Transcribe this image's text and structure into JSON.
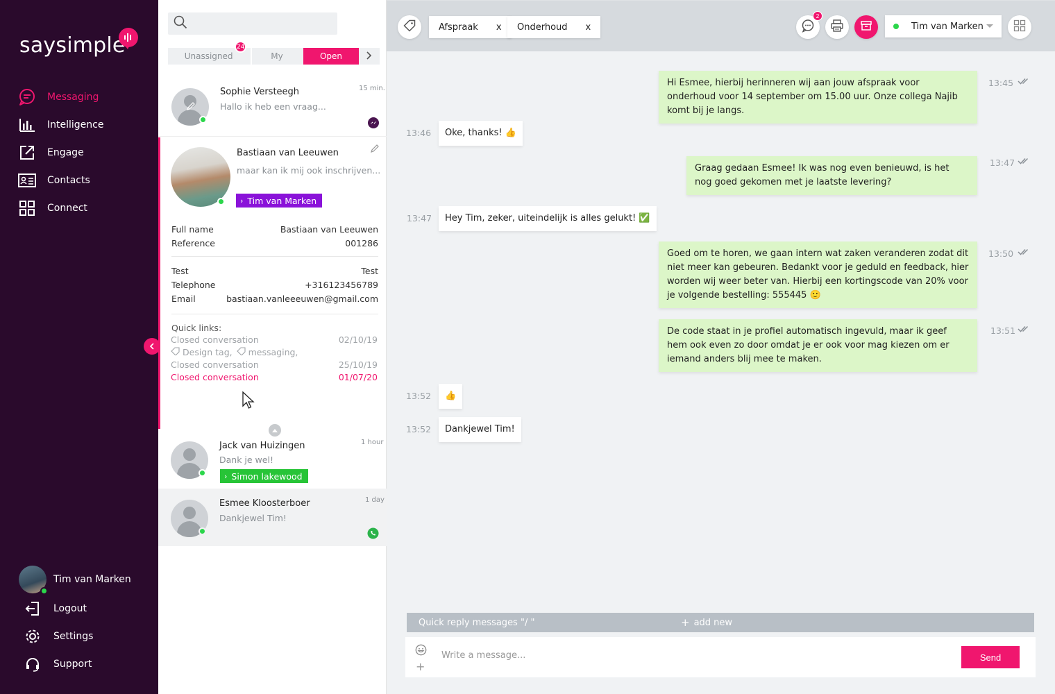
{
  "brand": {
    "name": "saysimple",
    "accent": "#f0166e",
    "sidebar_bg": "#2a0a2c"
  },
  "nav": {
    "items": [
      {
        "label": "Messaging",
        "icon": "chat-icon",
        "active": true
      },
      {
        "label": "Intelligence",
        "icon": "bar-chart-icon"
      },
      {
        "label": "Engage",
        "icon": "external-link-icon"
      },
      {
        "label": "Contacts",
        "icon": "contact-card-icon"
      },
      {
        "label": "Connect",
        "icon": "grid-icon"
      }
    ]
  },
  "user": {
    "name": "Tim van Marken",
    "status": "online"
  },
  "bottom_nav": {
    "logout": "Logout",
    "settings": "Settings",
    "support": "Support"
  },
  "search": {
    "placeholder": ""
  },
  "tabs": {
    "unassigned": "Unassigned",
    "unassigned_count": "24",
    "my": "My",
    "open": "Open"
  },
  "conversations": [
    {
      "name": "Sophie Versteegh",
      "preview": "Hallo ik heb een vraag...",
      "time": "15 min.",
      "channel": "messenger-icon"
    },
    {
      "name": "Bastiaan van Leeuwen",
      "preview": "maar kan ik mij ook inschrijven...",
      "agent": "Tim van Marken",
      "details": {
        "full_name_label": "Full name",
        "full_name": "Bastiaan van Leeuwen",
        "reference_label": "Reference",
        "reference": "001286",
        "test_label": "Test",
        "test": "Test",
        "telephone_label": "Telephone",
        "telephone": "+316123456789",
        "email_label": "Email",
        "email": "bastiaan.vanleeeuwen@gmail.com"
      },
      "quick_links_title": "Quick links:",
      "quick_links": [
        {
          "label": "Closed conversation",
          "date": "02/10/19"
        },
        {
          "tag1": "Design tag,",
          "tag2": "messaging,"
        },
        {
          "label": "Closed conversation",
          "date": "25/10/19"
        },
        {
          "label": "Closed conversation",
          "date": "01/07/20",
          "highlight": true
        }
      ]
    },
    {
      "name": "Jack van Huizingen",
      "preview": "Dank je wel!",
      "time": "1 hour",
      "agent": "Simon lakewood"
    },
    {
      "name": "Esmee Kloosterboer",
      "preview": "Dankjewel Tim!",
      "time": "1 day",
      "channel": "whatsapp-icon"
    }
  ],
  "header": {
    "labels": [
      "Afspraak",
      "Onderhoud"
    ],
    "label_remove": "x",
    "chat_badge": "2",
    "agent": "Tim van Marken"
  },
  "messages": [
    {
      "dir": "out",
      "time": "13:45",
      "text": "Hi Esmee, hierbij herinneren wij aan jouw afspraak voor onderhoud voor 14 september om 15.00 uur. Onze collega Najib komt bij je langs."
    },
    {
      "dir": "in",
      "time": "13:46",
      "text": "Oke, thanks! 👍"
    },
    {
      "dir": "out",
      "time": "13:47",
      "text": "Graag gedaan Esmee! Ik was nog even benieuwd, is het nog goed gekomen met je laatste levering?"
    },
    {
      "dir": "in",
      "time": "13:47",
      "text": "Hey Tim, zeker, uiteindelijk is alles gelukt! ✅"
    },
    {
      "dir": "out",
      "time": "13:50",
      "text": "Goed om te horen, we gaan intern wat zaken veranderen zodat dit niet meer kan gebeuren. Bedankt voor je geduld en feedback, hier worden wij weer beter van. Hierbij een kortingscode van 20% voor je volgende bestelling: 555445 🙂"
    },
    {
      "dir": "out",
      "time": "13:51",
      "text": "De code staat in je profiel automatisch ingevuld, maar ik geef hem ook even zo door omdat je er ook voor mag kiezen om er iemand anders blij mee te maken."
    },
    {
      "dir": "in",
      "time": "13:52",
      "text": "👍"
    },
    {
      "dir": "in",
      "time": "13:52",
      "text": "Dankjewel Tim!"
    }
  ],
  "quick_reply": {
    "label": "Quick reply messages \"/ \"",
    "add": "add new"
  },
  "composer": {
    "placeholder": "Write a message...",
    "send": "Send"
  }
}
